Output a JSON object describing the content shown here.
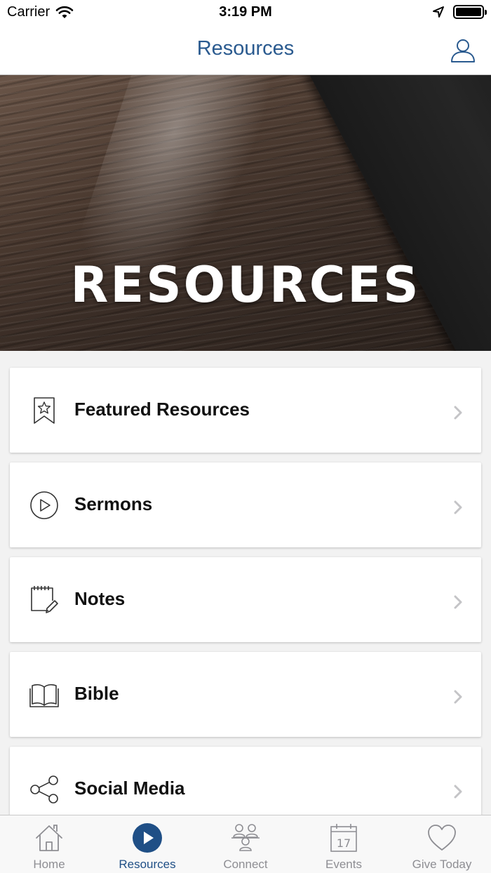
{
  "status_bar": {
    "carrier": "Carrier",
    "time": "3:19 PM",
    "battery_level": 1.0
  },
  "nav": {
    "title": "Resources",
    "profile_icon": "person-icon"
  },
  "hero": {
    "title": "RESOURCES"
  },
  "menu": {
    "items": [
      {
        "label": "Featured Resources",
        "icon": "bookmark-star-icon"
      },
      {
        "label": "Sermons",
        "icon": "play-circle-icon"
      },
      {
        "label": "Notes",
        "icon": "notepad-pencil-icon"
      },
      {
        "label": "Bible",
        "icon": "open-book-icon"
      },
      {
        "label": "Social Media",
        "icon": "share-icon"
      }
    ]
  },
  "tabs": {
    "items": [
      {
        "label": "Home",
        "icon": "home-icon",
        "active": false
      },
      {
        "label": "Resources",
        "icon": "play-circle-filled-icon",
        "active": true
      },
      {
        "label": "Connect",
        "icon": "people-group-icon",
        "active": false
      },
      {
        "label": "Events",
        "icon": "calendar-icon",
        "active": false,
        "calendar_day": "17"
      },
      {
        "label": "Give Today",
        "icon": "heart-icon",
        "active": false
      }
    ]
  },
  "colors": {
    "accent": "#2a5a8f",
    "tab_active": "#1f4f86",
    "tab_inactive": "#8e8e93",
    "background": "#f2f2f2"
  }
}
